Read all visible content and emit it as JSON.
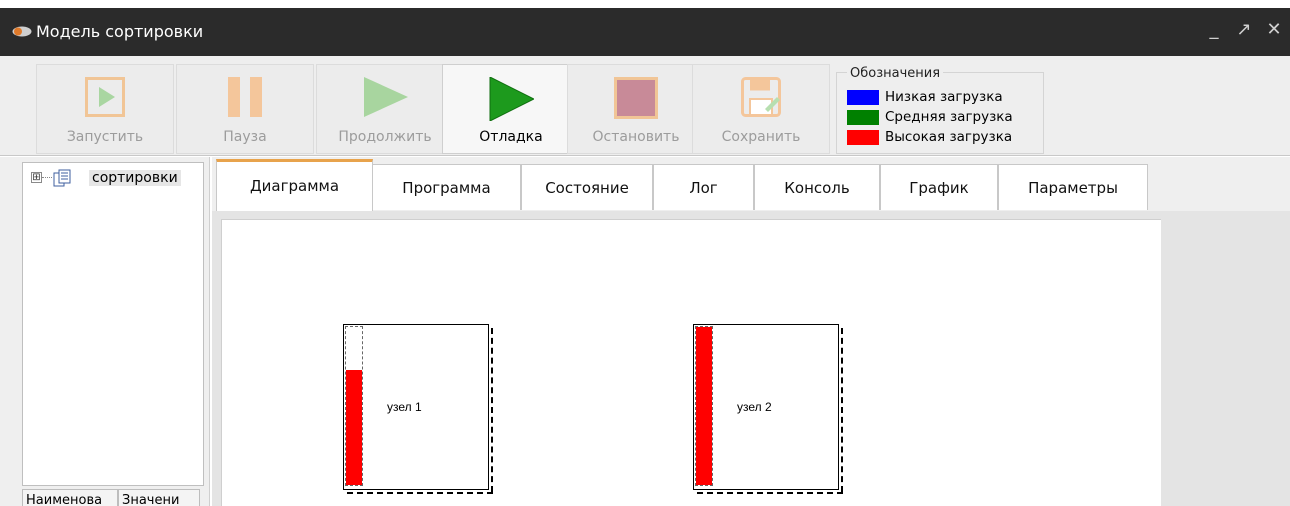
{
  "window": {
    "title": "Модель сортировки",
    "controls": [
      "_",
      "↗",
      "✕"
    ]
  },
  "toolbar": {
    "buttons": [
      {
        "label": "Запустить",
        "icon": "play-box-icon",
        "enabled": false
      },
      {
        "label": "Пауза",
        "icon": "pause-icon",
        "enabled": false
      },
      {
        "label": "Продолжить",
        "icon": "continue-icon",
        "enabled": false
      },
      {
        "label": "Отладка",
        "icon": "debug-play-icon",
        "enabled": true
      },
      {
        "label": "Остановить",
        "icon": "stop-icon",
        "enabled": false
      },
      {
        "label": "Сохранить",
        "icon": "save-icon",
        "enabled": false
      }
    ]
  },
  "legend": {
    "title": "Обозначения",
    "items": [
      {
        "label": "Низкая загрузка",
        "color": "#0000ff"
      },
      {
        "label": "Средняя загрузка",
        "color": "#008000"
      },
      {
        "label": "Высокая загрузка",
        "color": "#ff0000"
      }
    ]
  },
  "tree": {
    "root_label": "сортировки",
    "expander": "⊞"
  },
  "properties": {
    "columns": [
      "Наименова",
      "Значени"
    ]
  },
  "tabs": {
    "items": [
      "Диаграмма",
      "Программа",
      "Состояние",
      "Лог",
      "Консоль",
      "График",
      "Параметры"
    ],
    "active": "Диаграмма"
  },
  "diagram": {
    "nodes": [
      {
        "name": "узел 1",
        "load_fraction": 0.73,
        "load_color": "#ff0000"
      },
      {
        "name": "узел 2",
        "load_fraction": 1.0,
        "load_color": "#ff0000"
      }
    ]
  }
}
